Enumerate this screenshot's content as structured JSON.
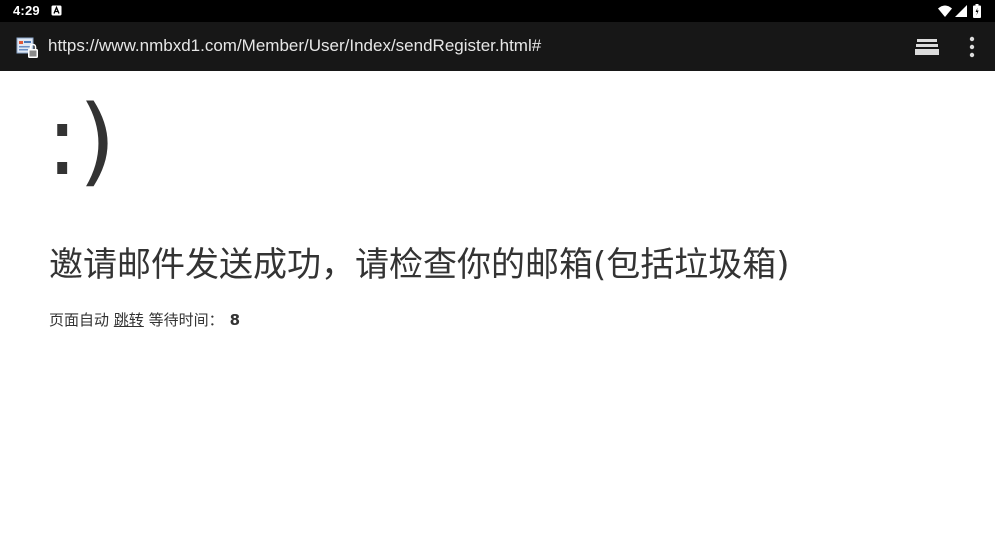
{
  "status_bar": {
    "time": "4:29",
    "notification_icon": "app-notification-icon",
    "wifi_icon": "wifi-icon",
    "signal_icon": "signal-icon",
    "battery_icon": "battery-icon"
  },
  "browser": {
    "url": "https://www.nmbxd1.com/Member/User/Index/sendRegister.html#",
    "favicon": "site-favicon-icon",
    "tabs_icon": "tabs-icon",
    "menu_icon": "more-vert-icon"
  },
  "page": {
    "smiley": ":)",
    "message": "邀请邮件发送成功，请检查你的邮箱(包括垃圾箱)",
    "redirect_prefix": "页面自动",
    "redirect_link": "跳转",
    "redirect_suffix": "等待时间：",
    "countdown": "8"
  },
  "colors": {
    "status_bar_bg": "#000000",
    "url_bar_bg": "#171717",
    "text": "#333333"
  }
}
